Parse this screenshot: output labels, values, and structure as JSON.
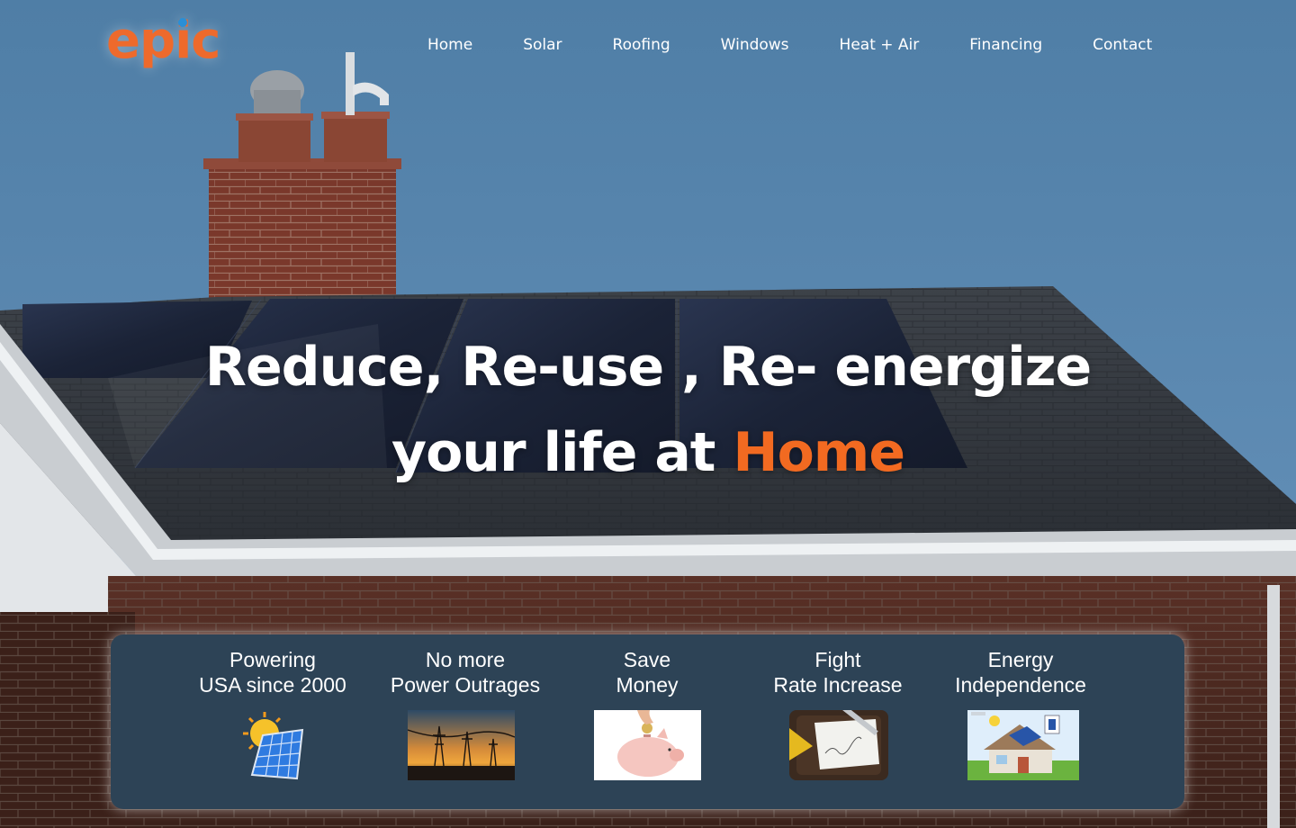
{
  "brand": {
    "logo_text": "epic"
  },
  "nav": {
    "items": [
      {
        "label": "Home"
      },
      {
        "label": "Solar"
      },
      {
        "label": "Roofing"
      },
      {
        "label": "Windows"
      },
      {
        "label": "Heat + Air"
      },
      {
        "label": "Financing"
      },
      {
        "label": "Contact"
      }
    ]
  },
  "hero": {
    "line1": "Reduce, Re-use , Re- energize",
    "line2_prefix": "your life at ",
    "line2_accent": "Home"
  },
  "features": [
    {
      "line1": "Powering",
      "line2": "USA since 2000",
      "image": "solar-panel-sun-icon"
    },
    {
      "line1": "No more",
      "line2": "Power Outrages",
      "image": "power-lines-sunset-photo"
    },
    {
      "line1": "Save",
      "line2": "Money",
      "image": "piggy-bank-photo"
    },
    {
      "line1": "Fight",
      "line2": "Rate Increase",
      "image": "desk-planning-photo"
    },
    {
      "line1": "Energy",
      "line2": "Independence",
      "image": "solar-house-diagram"
    }
  ],
  "colors": {
    "accent": "#f26a21",
    "panel": "#2d4356",
    "sky": "#5b87ad"
  }
}
